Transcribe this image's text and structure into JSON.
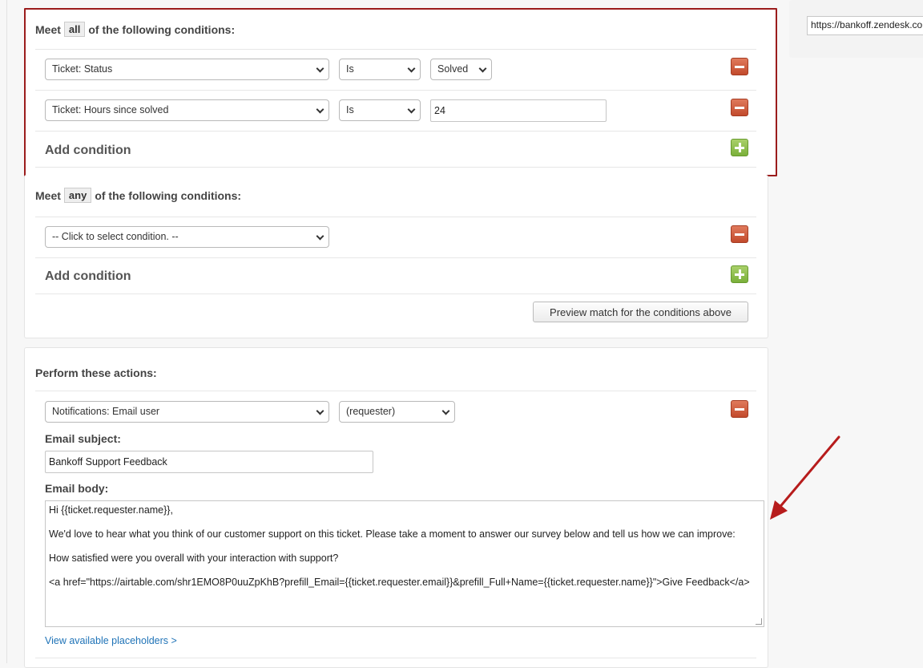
{
  "side": {
    "url_value": "https://bankoff.zendesk.com"
  },
  "all_conditions": {
    "meet_prefix": "Meet",
    "qualifier": "all",
    "meet_suffix": "of the following conditions:",
    "rows": [
      {
        "field": "Ticket: Status",
        "operator": "Is",
        "value": "Solved",
        "value_type": "select"
      },
      {
        "field": "Ticket: Hours since solved",
        "operator": "Is",
        "value": "24",
        "value_type": "text"
      }
    ],
    "add_label": "Add condition"
  },
  "any_conditions": {
    "meet_prefix": "Meet",
    "qualifier": "any",
    "meet_suffix": "of the following conditions:",
    "rows": [
      {
        "field": "-- Click to select condition. --"
      }
    ],
    "add_label": "Add condition",
    "preview_label": "Preview match for the conditions above"
  },
  "actions": {
    "title": "Perform these actions:",
    "action_field": "Notifications: Email user",
    "action_target": "(requester)",
    "subject_label": "Email subject:",
    "subject_value": "Bankoff Support Feedback",
    "body_label": "Email body:",
    "body_lines": [
      "Hi {{ticket.requester.name}},",
      "We'd love to hear what you think of our customer support on this ticket. Please take a moment to answer our survey below and tell us how we can improve:",
      "How satisfied were you overall with your interaction with support?",
      "<a href=\"https://airtable.com/shr1EMO8P0uuZpKhB?prefill_Email={{ticket.requester.email}}&prefill_Full+Name={{ticket.requester.name}}\">Give Feedback</a>"
    ],
    "placeholders_link": "View available placeholders >"
  },
  "colors": {
    "highlight_border": "#9b1c1c",
    "remove_button": "#c24a2c",
    "add_button": "#7ab03a",
    "link": "#1f73b7",
    "annotation_arrow": "#b71c1c"
  },
  "icons": {
    "remove": "minus-icon",
    "add": "plus-icon",
    "dropdown": "chevron-down-icon",
    "annotation": "arrow-annotation"
  }
}
